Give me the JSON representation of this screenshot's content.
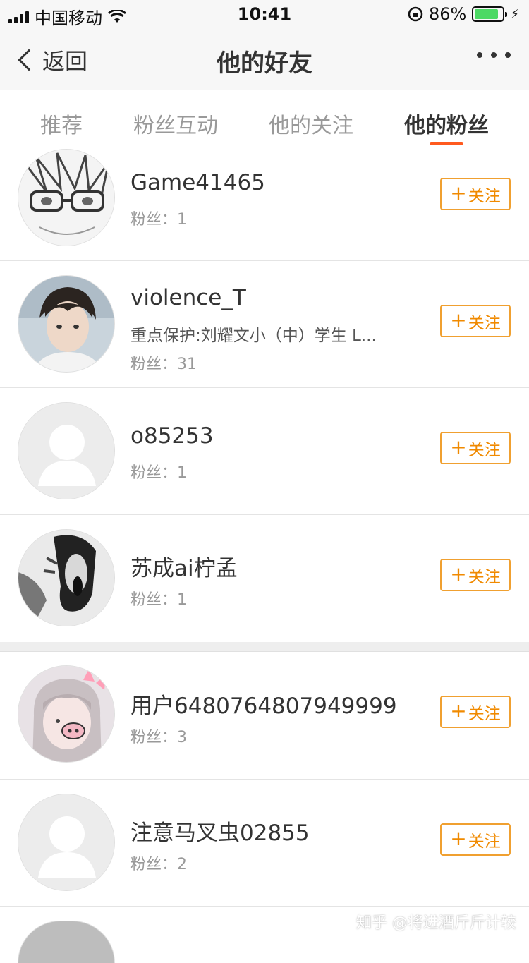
{
  "status_bar": {
    "carrier": "中国移动",
    "time": "10:41",
    "battery_percent": "86%",
    "battery_level": 0.86,
    "battery_color": "#4cd964"
  },
  "navbar": {
    "back_label": "返回",
    "title": "他的好友",
    "more_icon": "ellipsis-icon"
  },
  "tabs": [
    {
      "label": "推荐",
      "active": false
    },
    {
      "label": "粉丝互动",
      "active": false
    },
    {
      "label": "他的关注",
      "active": false
    },
    {
      "label": "他的粉丝",
      "active": true
    }
  ],
  "accent_color": "#ff5a1f",
  "follow_color": "#f08a00",
  "follow_label": "关注",
  "users": [
    {
      "name": "Game41465",
      "desc": "",
      "fans": "粉丝：1"
    },
    {
      "name": "violence_T",
      "desc": "重点保护:刘耀文小（中）学生 L...",
      "fans": "粉丝：31"
    },
    {
      "name": "o85253",
      "desc": "",
      "fans": "粉丝：1"
    },
    {
      "name": "苏成ai柠孟",
      "desc": "",
      "fans": "粉丝：1"
    },
    {
      "name": "用户6480764807949999",
      "desc": "",
      "fans": "粉丝：3"
    },
    {
      "name": "注意马叉虫02855",
      "desc": "",
      "fans": "粉丝：2"
    }
  ],
  "watermark": "知乎 @将进酒斤斤计较"
}
